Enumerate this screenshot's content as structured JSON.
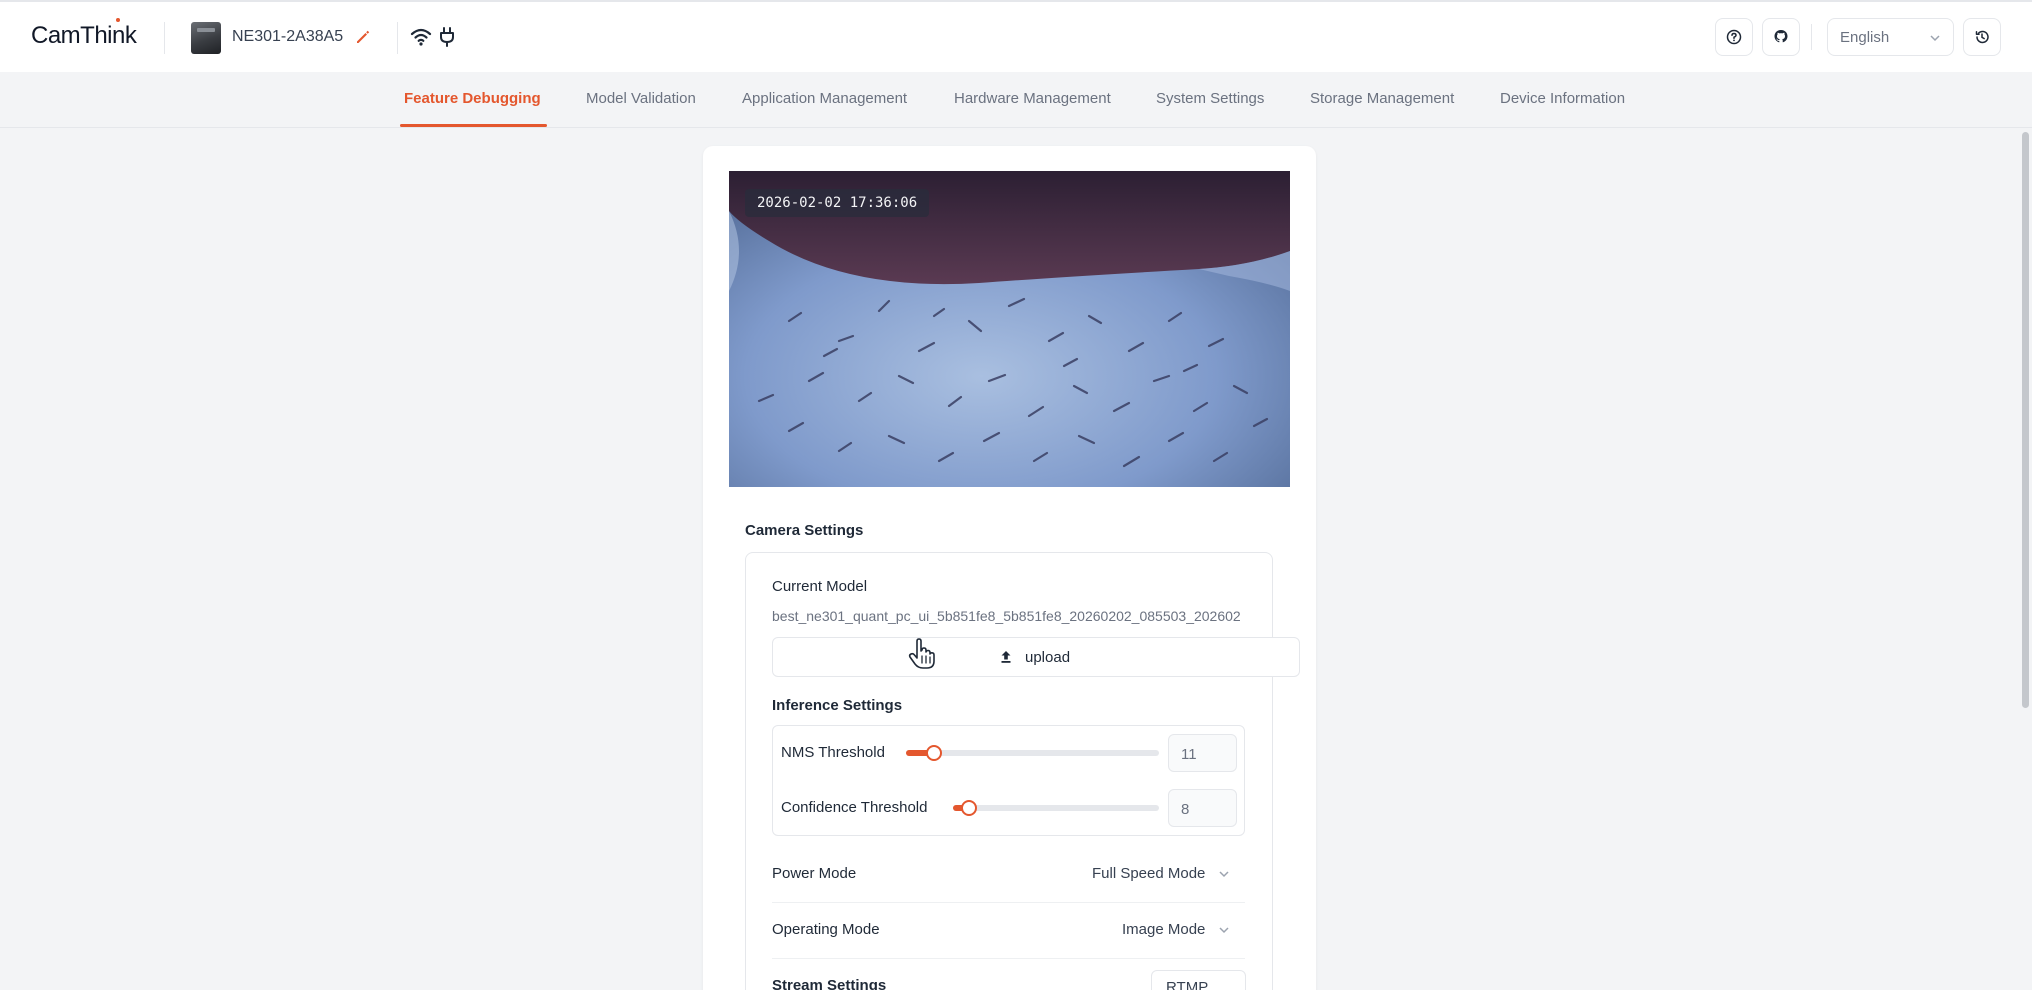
{
  "app": {
    "logo_text": "CamThink"
  },
  "device": {
    "name": "NE301-2A38A5",
    "edit_icon": "pencil-icon",
    "wifi_icon": "wifi-icon",
    "power_icon": "plug-icon"
  },
  "header_actions": {
    "help_icon": "help-icon",
    "github_icon": "github-icon",
    "language": "English",
    "history_icon": "history-icon"
  },
  "tabs": [
    {
      "label": "Feature Debugging",
      "active": true
    },
    {
      "label": "Model Validation"
    },
    {
      "label": "Application Management"
    },
    {
      "label": "Hardware Management"
    },
    {
      "label": "System Settings"
    },
    {
      "label": "Storage Management"
    },
    {
      "label": "Device Information"
    }
  ],
  "preview": {
    "timestamp": "2026-02-02 17:36:06"
  },
  "camera_settings": {
    "title": "Camera Settings",
    "current_model_label": "Current Model",
    "current_model_value": "best_ne301_quant_pc_ui_5b851fe8_5b851fe8_20260202_085503_202602",
    "upload_label": "upload",
    "inference_title": "Inference Settings",
    "nms": {
      "label": "NMS Threshold",
      "value": "11",
      "fraction": 0.11
    },
    "confidence": {
      "label": "Confidence Threshold",
      "value": "8",
      "fraction": 0.08
    },
    "power_mode": {
      "label": "Power Mode",
      "value": "Full Speed Mode"
    },
    "operating_mode": {
      "label": "Operating Mode",
      "value": "Image Mode"
    },
    "stream_settings": {
      "label": "Stream Settings",
      "value": "RTMP"
    }
  },
  "colors": {
    "accent": "#e4572e",
    "background": "#f3f4f6",
    "card": "#ffffff"
  }
}
